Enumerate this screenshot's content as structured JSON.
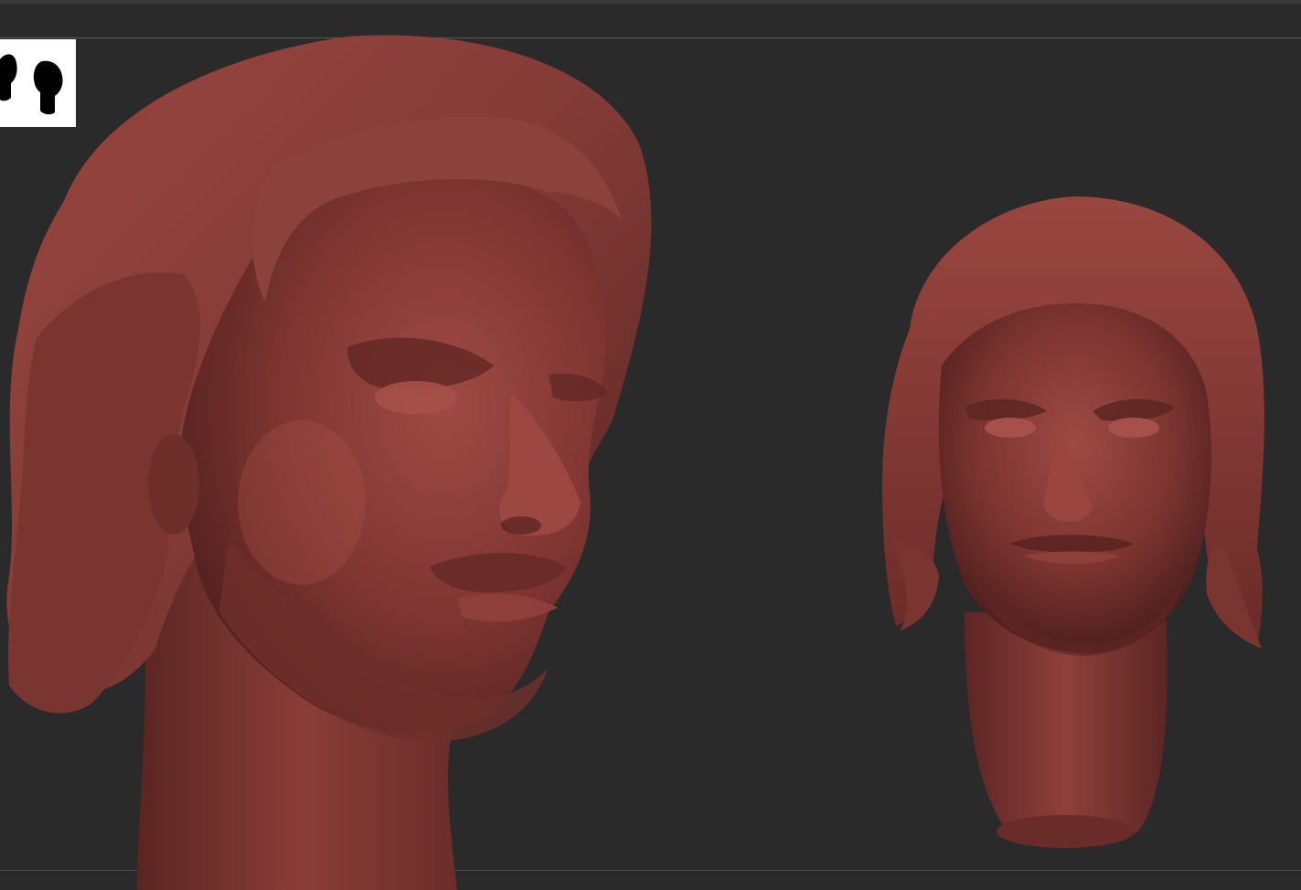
{
  "viewport": {
    "background_color": "#2a2a2a",
    "material_color": "#8a3c38"
  },
  "navigator": {
    "icon": "head-silhouettes-icon"
  },
  "models": [
    {
      "name": "head-sculpt-three-quarter-view",
      "icon": "sculpted-head-icon"
    },
    {
      "name": "head-sculpt-front-view",
      "icon": "sculpted-head-icon"
    }
  ]
}
